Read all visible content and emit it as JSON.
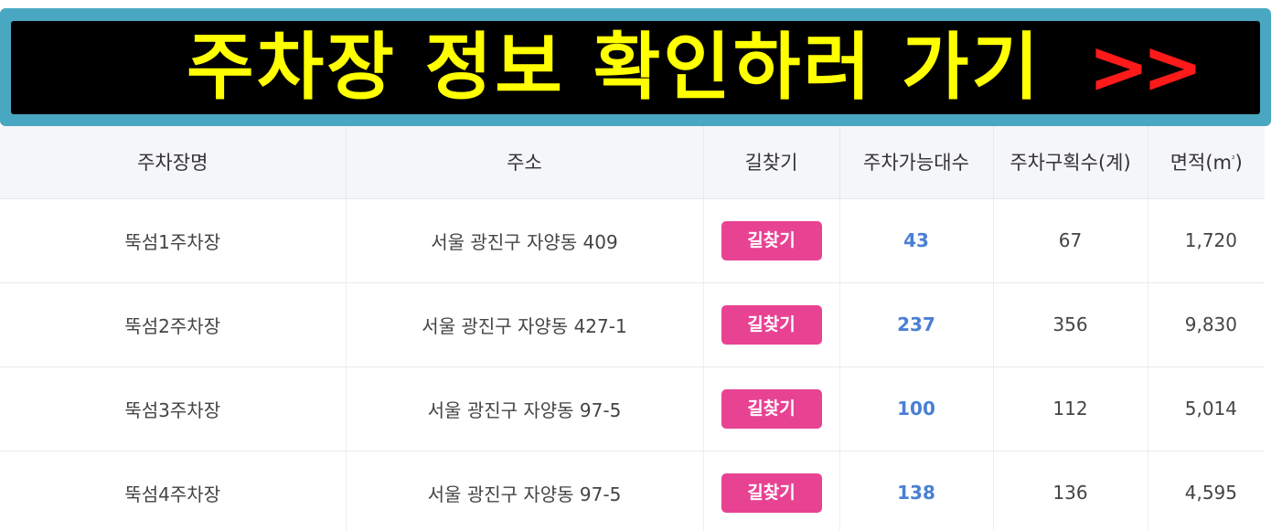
{
  "banner": {
    "text": "주차장 정보 확인하러 가기",
    "arrows": ">>"
  },
  "table": {
    "headers": {
      "name": "주차장명",
      "address": "주소",
      "directions": "길찾기",
      "available": "주차가능대수",
      "sections": "주차구획수(계)",
      "area": "면적(m",
      "area_sup": "²",
      "area_close": ")"
    },
    "rows": [
      {
        "name": "뚝섬1주차장",
        "address": "서울 광진구 자양동 409",
        "button": "길찾기",
        "available": "43",
        "sections": "67",
        "area": "1,720"
      },
      {
        "name": "뚝섬2주차장",
        "address": "서울 광진구 자양동 427-1",
        "button": "길찾기",
        "available": "237",
        "sections": "356",
        "area": "9,830"
      },
      {
        "name": "뚝섬3주차장",
        "address": "서울 광진구 자양동 97-5",
        "button": "길찾기",
        "available": "100",
        "sections": "112",
        "area": "5,014"
      },
      {
        "name": "뚝섬4주차장",
        "address": "서울 광진구 자양동 97-5",
        "button": "길찾기",
        "available": "138",
        "sections": "136",
        "area": "4,595"
      }
    ]
  },
  "colors": {
    "banner_border": "#4aa7c1",
    "banner_bg": "#000000",
    "banner_text": "#ffff00",
    "banner_arrows": "#ff1a1a",
    "button_bg": "#e84393",
    "available_text": "#4a7fd4",
    "header_bg": "#f5f6f9"
  }
}
